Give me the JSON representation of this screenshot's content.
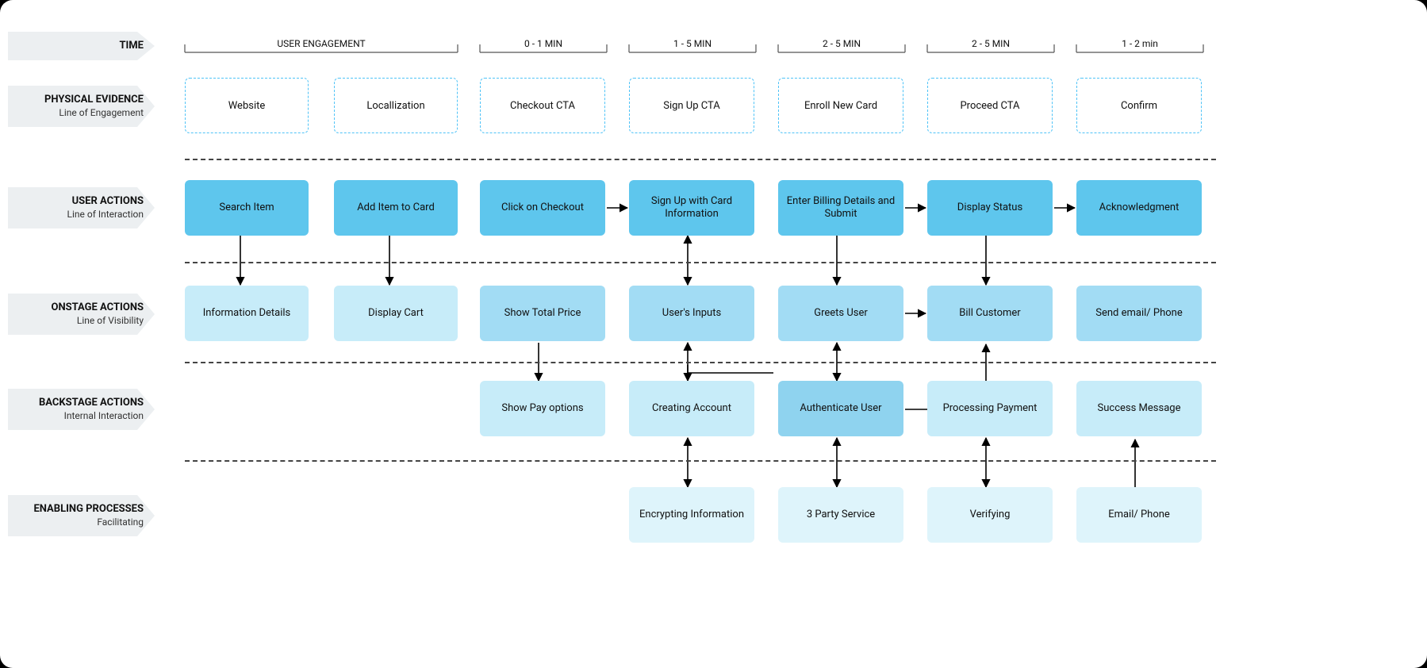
{
  "rows": {
    "time": {
      "title": "TIME"
    },
    "evidence": {
      "title": "PHYSICAL EVIDENCE",
      "sub": "Line of Engagement"
    },
    "user": {
      "title": "USER ACTIONS",
      "sub": "Line of Interaction"
    },
    "onstage": {
      "title": "ONSTAGE ACTIONS",
      "sub": "Line of Visibility"
    },
    "backstage": {
      "title": "BACKSTAGE ACTIONS",
      "sub": "Internal Interaction"
    },
    "enabling": {
      "title": "ENABLING PROCESSES",
      "sub": "Facilitating"
    }
  },
  "time_headers": [
    "USER ENGAGEMENT",
    "0 - 1 MIN",
    "1 - 5 MIN",
    "2 - 5 MIN",
    "2 - 5 MIN",
    "1 - 2 min"
  ],
  "evidence": [
    "Website",
    "Locallization",
    "Checkout CTA",
    "Sign Up CTA",
    "Enroll New Card",
    "Proceed CTA",
    "Confirm"
  ],
  "user_actions": [
    "Search Item",
    "Add Item to Card",
    "Click on Checkout",
    "Sign Up with Card Information",
    "Enter Billing Details and Submit",
    "Display Status",
    "Acknowledgment"
  ],
  "onstage": [
    "Information Details",
    "Display Cart",
    "Show Total Price",
    "User's Inputs",
    "Greets User",
    "Bill Customer",
    "Send email/ Phone"
  ],
  "backstage": [
    "Show Pay options",
    "Creating Account",
    "Authenticate User",
    "Processing Payment",
    "Success Message"
  ],
  "enabling": [
    "Encrypting Information",
    "3 Party Service",
    "Verifying",
    "Email/ Phone"
  ]
}
